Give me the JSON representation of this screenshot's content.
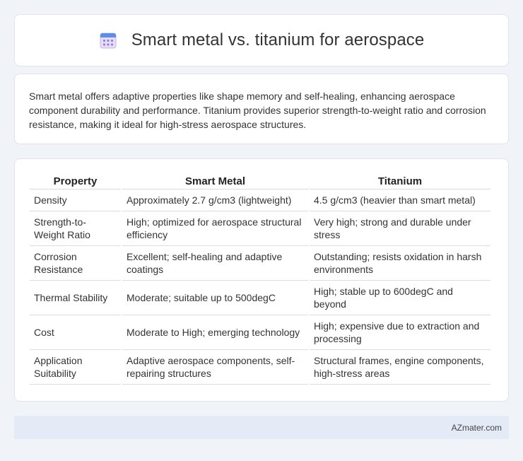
{
  "header": {
    "title": "Smart metal vs. titanium for aerospace",
    "icon": "calendar-icon",
    "icon_color": "#7b61c9"
  },
  "summary": {
    "text": "Smart metal offers adaptive properties like shape memory and self-healing, enhancing aerospace component durability and performance. Titanium provides superior strength-to-weight ratio and corrosion resistance, making it ideal for high-stress aerospace structures."
  },
  "table": {
    "headers": [
      "Property",
      "Smart Metal",
      "Titanium"
    ],
    "rows": [
      [
        "Density",
        "Approximately 2.7 g/cm3 (lightweight)",
        "4.5 g/cm3 (heavier than smart metal)"
      ],
      [
        "Strength-to-Weight Ratio",
        "High; optimized for aerospace structural efficiency",
        "Very high; strong and durable under stress"
      ],
      [
        "Corrosion Resistance",
        "Excellent; self-healing and adaptive coatings",
        "Outstanding; resists oxidation in harsh environments"
      ],
      [
        "Thermal Stability",
        "Moderate; suitable up to 500degC",
        "High; stable up to 600degC and beyond"
      ],
      [
        "Cost",
        "Moderate to High; emerging technology",
        "High; expensive due to extraction and processing"
      ],
      [
        "Application Suitability",
        "Adaptive aerospace components, self-repairing structures",
        "Structural frames, engine components, high-stress areas"
      ]
    ]
  },
  "footer": {
    "brand": "AZmater.com"
  }
}
